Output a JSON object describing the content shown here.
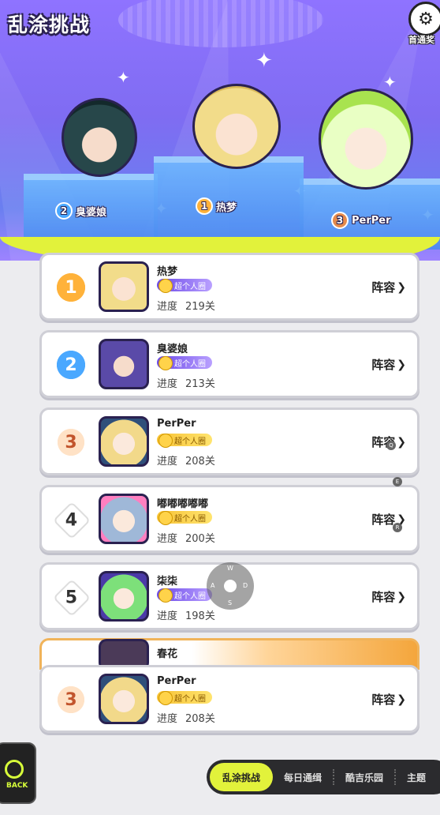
{
  "header": {
    "title": "乱涂挑战",
    "first_pass_label": "首通奖"
  },
  "podium": [
    {
      "rank": "2",
      "name": "臭婆娘",
      "color": "#4aa8ff"
    },
    {
      "rank": "1",
      "name": "热梦",
      "color": "#ffb23a"
    },
    {
      "rank": "3",
      "name": "PerPer",
      "color": "#e58a4c"
    }
  ],
  "list": [
    {
      "rank": "1",
      "name": "热梦",
      "tag": "超个人圈",
      "progress_label": "进度",
      "progress": "219关",
      "lineup": "阵容"
    },
    {
      "rank": "2",
      "name": "臭婆娘",
      "tag": "超个人圈",
      "progress_label": "进度",
      "progress": "213关",
      "lineup": "阵容"
    },
    {
      "rank": "3",
      "name": "PerPer",
      "tag": "超个人圈",
      "progress_label": "进度",
      "progress": "208关",
      "lineup": "阵容"
    },
    {
      "rank": "4",
      "name": "嘟嘟嘟嘟嘟",
      "tag": "超个人圈",
      "progress_label": "进度",
      "progress": "200关",
      "lineup": "阵容"
    },
    {
      "rank": "5",
      "name": "柒柒",
      "tag": "超个人圈",
      "progress_label": "进度",
      "progress": "198关",
      "lineup": "阵容"
    }
  ],
  "partial_row": {
    "name": "春花"
  },
  "my_rank": {
    "rank": "3",
    "name": "PerPer",
    "tag": "超个人圈",
    "progress_label": "进度",
    "progress": "208关",
    "lineup": "阵容"
  },
  "joystick": {
    "up": "W",
    "left": "A",
    "right": "D",
    "down": "S"
  },
  "overlay_dots": [
    "Q",
    "E",
    "R"
  ],
  "back_label": "BACK",
  "tabs": [
    {
      "label": "乱涂挑战",
      "active": true
    },
    {
      "label": "每日通缉",
      "active": false
    },
    {
      "label": "酷吉乐园",
      "active": false
    },
    {
      "label": "主题",
      "active": false
    }
  ],
  "colors": {
    "accent": "#e2f23b",
    "stage": "#8f73ff",
    "tab_bar": "#2b2b2e"
  }
}
